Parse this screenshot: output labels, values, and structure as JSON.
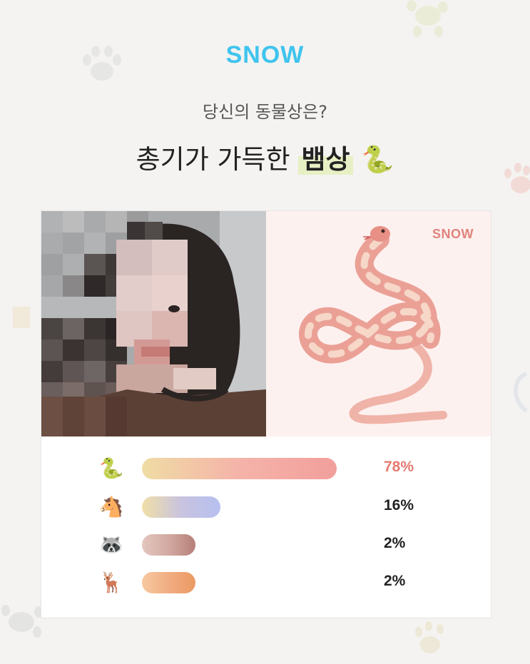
{
  "brand": "SNOW",
  "question": "당신의 동물상은?",
  "result": {
    "prefix": "총기가 가득한",
    "highlight": "뱀상",
    "emoji": "🐍"
  },
  "illustration": {
    "logo": "SNOW",
    "subject": "snake-illustration"
  },
  "colors": {
    "brand": "#3fc4ee",
    "highlight_bg": "#e7f0c4",
    "top_percent": "#e57a72"
  },
  "results": [
    {
      "animal": "snake",
      "emoji": "🐍",
      "value": 0.78,
      "label": "78%"
    },
    {
      "animal": "horse",
      "emoji": "🐴",
      "value": 0.16,
      "label": "16%"
    },
    {
      "animal": "raccoon",
      "emoji": "🦝",
      "value": 0.02,
      "label": "2%"
    },
    {
      "animal": "deer",
      "emoji": "🦌",
      "value": 0.02,
      "label": "2%"
    }
  ]
}
